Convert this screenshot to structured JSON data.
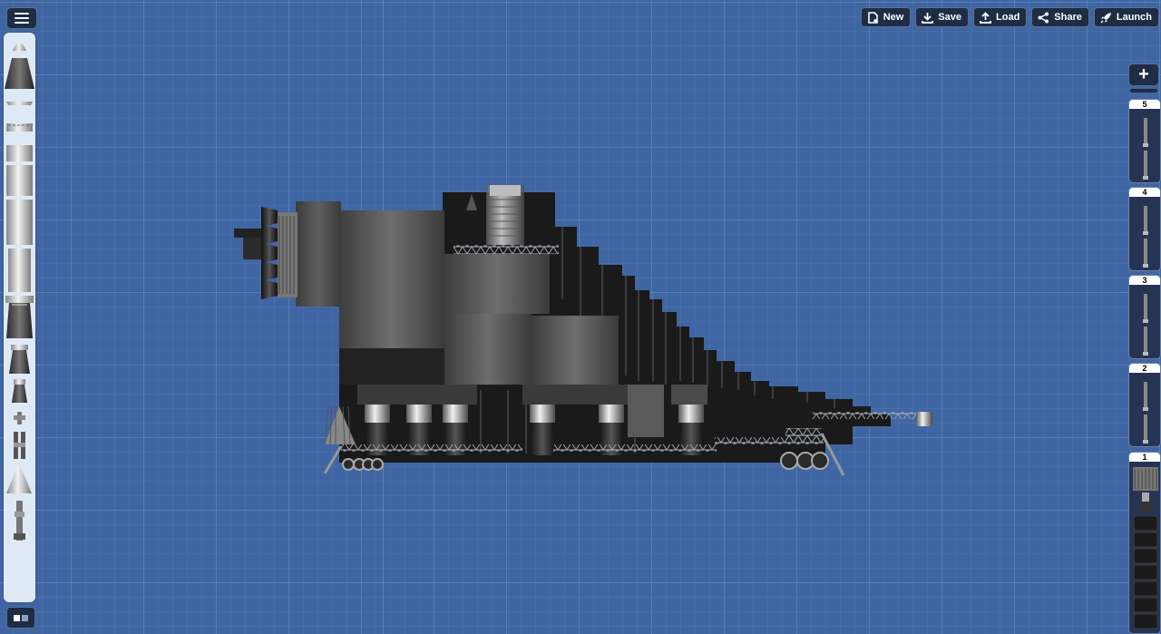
{
  "toolbar": {
    "new_label": "New",
    "save_label": "Save",
    "load_label": "Load",
    "share_label": "Share",
    "launch_label": "Launch"
  },
  "stages": {
    "add_label": "+",
    "items": [
      {
        "number": "5"
      },
      {
        "number": "4"
      },
      {
        "number": "3"
      },
      {
        "number": "2"
      },
      {
        "number": "1"
      }
    ]
  },
  "palette": {
    "parts": [
      "capsule-icon",
      "cone-nosecone-icon",
      "heat-shield-icon",
      "docking-port-icon",
      "fuel-tank-small-icon",
      "fuel-tank-medium-icon",
      "fuel-tank-large-icon",
      "fuel-tank-tall-icon",
      "engine-large-icon",
      "engine-medium-icon",
      "engine-small-icon",
      "rcs-thruster-icon",
      "separator-icon",
      "fairing-cone-icon",
      "landing-leg-icon"
    ]
  },
  "colors": {
    "background": "#3f66a3",
    "panel": "#1e2c44",
    "palette_bg": "#dfe9f6"
  }
}
